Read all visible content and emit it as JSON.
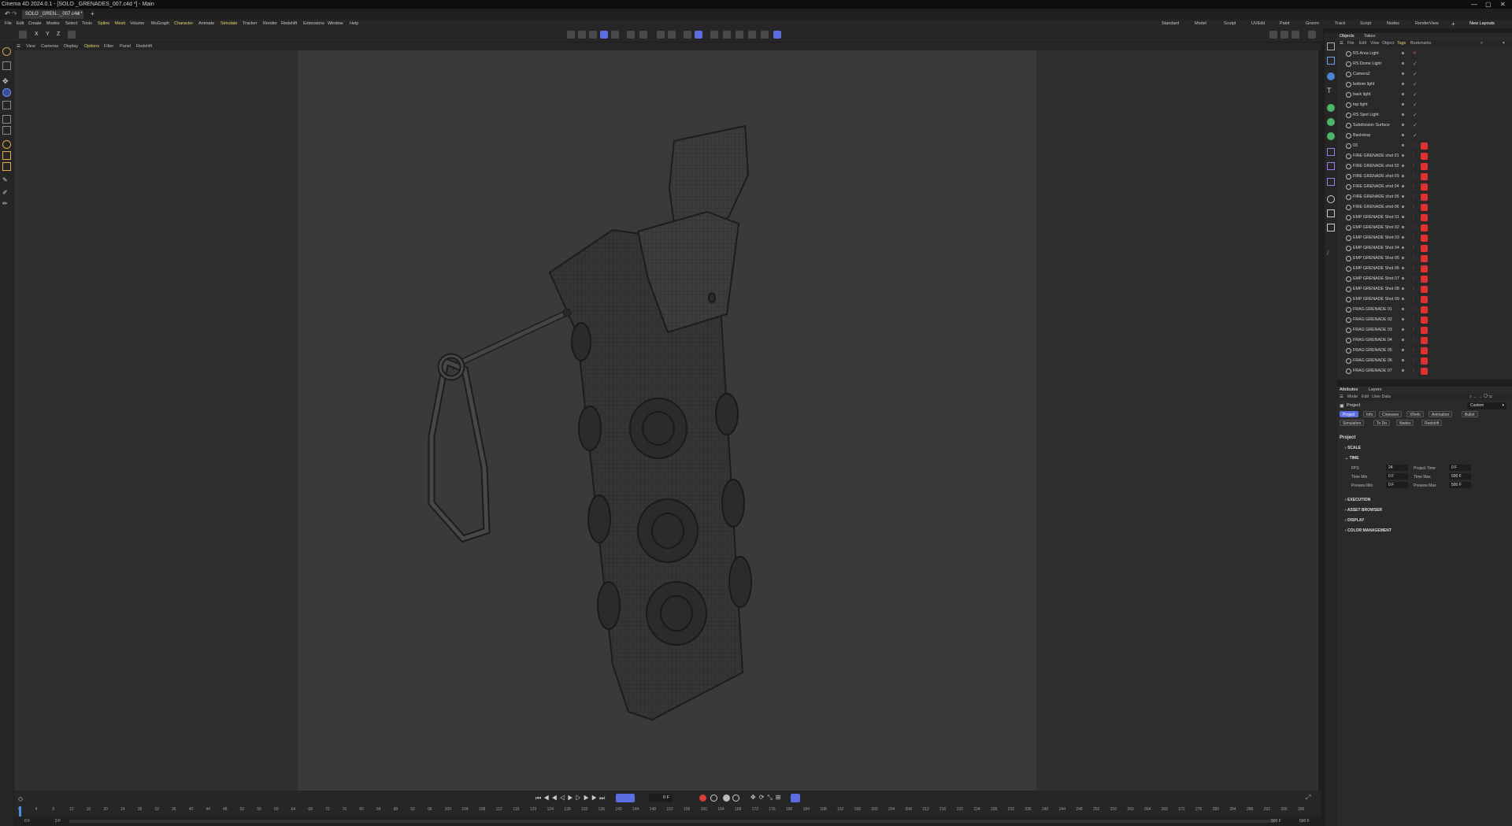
{
  "window": {
    "title": "Cinema 4D 2024.0.1 - [SOLO _GRENADES_007.c4d *] - Main"
  },
  "doc_tab": {
    "label": "SOLO _GREN..._007.c4d *",
    "add": "+"
  },
  "menu": [
    "File",
    "Edit",
    "Create",
    "Modes",
    "Select",
    "Tools",
    "Spline",
    "Mesh",
    "Volume",
    "MoGraph",
    "Character",
    "Animate",
    "Simulate",
    "Tracker",
    "Render",
    "Redshift",
    "Extensions",
    "Window",
    "Help"
  ],
  "layouts": [
    "Standard",
    "Model",
    "Sculpt",
    "UVEdit",
    "Paint",
    "Groom",
    "Track",
    "Script",
    "Nodes",
    "RenderView"
  ],
  "new_layouts": "New Layouts",
  "axis_buttons": [
    "X",
    "Y",
    "Z"
  ],
  "viewport_menu": [
    "View",
    "Cameras",
    "Display",
    "Options",
    "Filter",
    "Panel",
    "Redshift"
  ],
  "objects_panel": {
    "tabs": [
      "Objects",
      "Takes"
    ],
    "menu": [
      "File",
      "Edit",
      "View",
      "Object",
      "Tags",
      "Bookmarks"
    ],
    "rows": [
      {
        "name": "RS Area Light",
        "status": "x"
      },
      {
        "name": "RS Dome Light",
        "status": "check"
      },
      {
        "name": "Camera2",
        "status": "check"
      },
      {
        "name": "bottom light",
        "status": "check"
      },
      {
        "name": "back light",
        "status": "check"
      },
      {
        "name": "top light",
        "status": "check"
      },
      {
        "name": "RS Spot Light",
        "status": "check"
      },
      {
        "name": "Subdivision Surface",
        "status": "check"
      },
      {
        "name": "Backdrop",
        "status": "check"
      },
      {
        "name": "03",
        "status": "dot"
      },
      {
        "name": "FIRE GRENADE shot 01",
        "status": "dot"
      },
      {
        "name": "FIRE GRENADE shot 02",
        "status": "dot"
      },
      {
        "name": "FIRE GRENADE shot 03",
        "status": "dot"
      },
      {
        "name": "FIRE GRENADE shot 04",
        "status": "dot"
      },
      {
        "name": "FIRE GRENADE shot 05",
        "status": "dot"
      },
      {
        "name": "FIRE GRENADE shot 06",
        "status": "dot"
      },
      {
        "name": "EMP GRENADE Shot 01",
        "status": "dot"
      },
      {
        "name": "EMP GRENADE Shot 02",
        "status": "dot"
      },
      {
        "name": "EMP GRENADE Shot 03",
        "status": "dot"
      },
      {
        "name": "EMP GRENADE Shot 04",
        "status": "dot"
      },
      {
        "name": "EMP GRENADE Shot 05",
        "status": "dot"
      },
      {
        "name": "EMP GRENADE Shot 06",
        "status": "dot"
      },
      {
        "name": "EMP GRENADE Shot 07",
        "status": "dot"
      },
      {
        "name": "EMP GRENADE Shot 08",
        "status": "dot"
      },
      {
        "name": "EMP GRENADE Shot 09",
        "status": "dot"
      },
      {
        "name": "FRAG GRENADE 01",
        "status": "dot"
      },
      {
        "name": "FRAG GRENADE 02",
        "status": "dot"
      },
      {
        "name": "FRAG GRENADE 03",
        "status": "dot"
      },
      {
        "name": "FRAG GRENADE 04",
        "status": "dot"
      },
      {
        "name": "FRAG GRENADE 05",
        "status": "dot"
      },
      {
        "name": "FRAG GRENADE 06",
        "status": "dot"
      },
      {
        "name": "FRAG GRENADE 07",
        "status": "dot"
      }
    ]
  },
  "attributes": {
    "tabs": [
      "Attributes",
      "Layers"
    ],
    "menu": [
      "Mode",
      "Edit",
      "User Data"
    ],
    "object": "Project",
    "preset": "Custom",
    "subtabs": [
      "Project",
      "Info",
      "Cineware",
      "XRefs",
      "Animation",
      "Bullet",
      "Simulation",
      "To Do",
      "Nodes",
      "Redshift"
    ],
    "heading": "Project",
    "sections": {
      "scale": "SCALE",
      "time": "TIME",
      "execution": "EXECUTION",
      "asset_browser": "ASSET BROWSER",
      "display": "DISPLAY",
      "color_management": "COLOR MANAGEMENT"
    },
    "fields": {
      "fps": {
        "label": "FPS",
        "value": "24"
      },
      "project_time": {
        "label": "Project Time",
        "value": "0 F"
      },
      "time_min": {
        "label": "Time Min",
        "value": "0 F"
      },
      "time_max": {
        "label": "Time Max",
        "value": "500 F"
      },
      "preview_min": {
        "label": "Preview Min",
        "value": "0 F"
      },
      "preview_max": {
        "label": "Preview Max",
        "value": "500 F"
      }
    }
  },
  "timeline": {
    "current_frame": "0 F",
    "ticks": [
      "0",
      "4",
      "8",
      "12",
      "16",
      "20",
      "24",
      "28",
      "32",
      "36",
      "40",
      "44",
      "48",
      "52",
      "56",
      "60",
      "64",
      "68",
      "72",
      "76",
      "80",
      "84",
      "88",
      "92",
      "96",
      "100",
      "104",
      "108",
      "112",
      "116",
      "120",
      "124",
      "128",
      "132",
      "136",
      "140",
      "144",
      "148",
      "152",
      "156",
      "160",
      "164",
      "168",
      "172",
      "176",
      "180",
      "184",
      "188",
      "192",
      "196",
      "200",
      "204",
      "208",
      "212",
      "216",
      "220",
      "224",
      "228",
      "232",
      "236",
      "240",
      "244",
      "248",
      "252",
      "256",
      "260",
      "264",
      "268",
      "272",
      "276",
      "280",
      "284",
      "288",
      "292",
      "296",
      "300"
    ],
    "start": "0 F",
    "start2": "0 F",
    "end": "500 F",
    "end2": "500 F"
  }
}
